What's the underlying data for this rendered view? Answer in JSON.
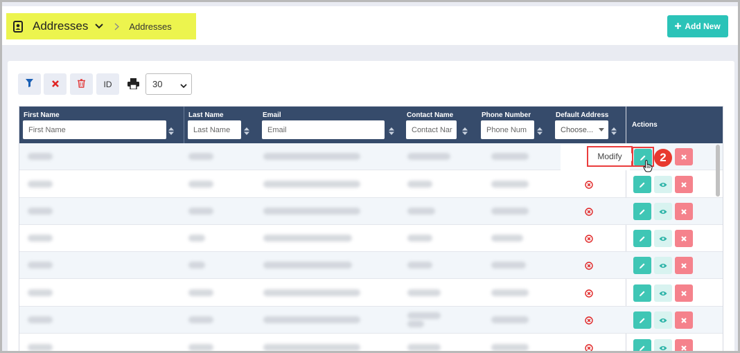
{
  "header": {
    "title": "Addresses",
    "breadcrumb": "Addresses",
    "add_button": "Add New",
    "icons": {
      "title": "address-book-icon",
      "dropdown": "chevron-down-icon",
      "separator": "chevron-right-icon",
      "add": "plus-icon"
    },
    "highlight_color": "#ecf44e",
    "accent_color": "#2bc3b8"
  },
  "toolbar": {
    "id_label": "ID",
    "page_size": "30",
    "buttons": [
      "filter-button",
      "clear-filter-button",
      "delete-button",
      "id-button",
      "print-button"
    ]
  },
  "table": {
    "columns": [
      {
        "label": "First Name",
        "placeholder": "First Name"
      },
      {
        "label": "Last Name",
        "placeholder": "Last Name"
      },
      {
        "label": "Email",
        "placeholder": "Email"
      },
      {
        "label": "Contact Name",
        "placeholder": "Contact Nar"
      },
      {
        "label": "Phone Number",
        "placeholder": "Phone Num"
      },
      {
        "label": "Default Address",
        "placeholder": "Choose..."
      }
    ],
    "actions_label": "Actions",
    "header_color": "#364b6b",
    "row_count_visible": 8
  },
  "annotation": {
    "tooltip": "Modify",
    "step_number": "2",
    "color": "#ea3c3c"
  }
}
